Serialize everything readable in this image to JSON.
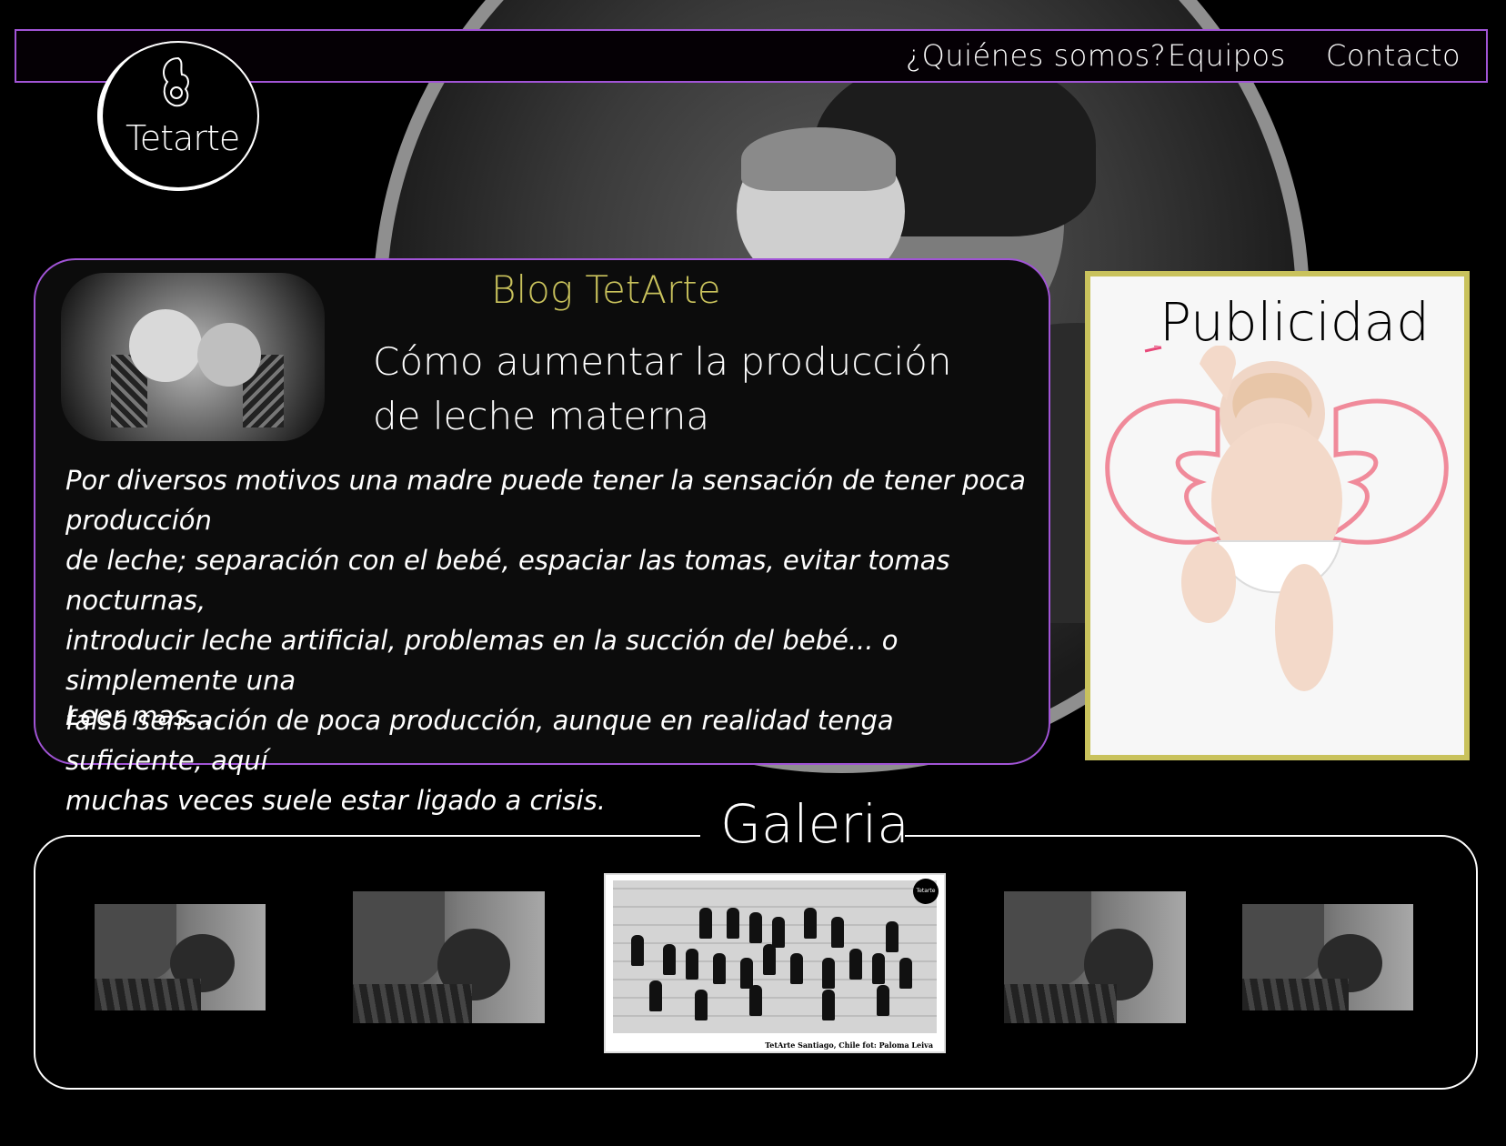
{
  "brand": {
    "name": "Tetarte"
  },
  "nav": {
    "links": [
      {
        "label": "¿Quiénes somos?"
      },
      {
        "label": "Equipos"
      },
      {
        "label": "Contacto"
      }
    ]
  },
  "blog": {
    "heading": "Blog TetArte",
    "post_title": "Cómo aumentar la producción de leche materna",
    "post_body": "Por diversos motivos una madre puede tener la sensación de tener poca producción\n de leche; separación con el bebé, espaciar las tomas, evitar  tomas nocturnas,\nintroducir leche artificial, problemas en la succión del bebé... o simplemente una\n falsa sensación de poca producción, aunque en  realidad tenga suficiente, aquí\nmuchas veces suele estar ligado a crisis.",
    "read_more": "Leer mas..."
  },
  "ad": {
    "title": "Publicidad"
  },
  "gallery": {
    "title": "Galeria",
    "featured_caption": "TetArte Santiago, Chile   fot: Paloma Leiva",
    "featured_logo": "Tetarte"
  },
  "colors": {
    "accent_purple": "#a154d6",
    "accent_gold": "#c9c25c",
    "background": "#000000"
  }
}
